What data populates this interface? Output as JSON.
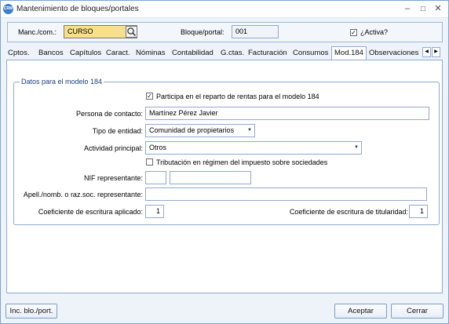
{
  "window": {
    "title": "Mantenimiento de bloques/portales",
    "app_icon_text": "CRM"
  },
  "topbar": {
    "manc_label": "Manc./com.:",
    "manc_value": "CURSO",
    "bloque_label": "Bloque/portal:",
    "bloque_value": "001",
    "activa_label": "¿Activa?",
    "activa_checked": true
  },
  "tabs": [
    {
      "label": "Cptos."
    },
    {
      "label": "Bancos"
    },
    {
      "label": "Capítulos"
    },
    {
      "label": "Caract."
    },
    {
      "label": "Nóminas"
    },
    {
      "label": "Contabilidad"
    },
    {
      "label": "G.ctas."
    },
    {
      "label": "Facturación"
    },
    {
      "label": "Consumos"
    },
    {
      "label": "Mod.184",
      "active": true
    },
    {
      "label": "Observaciones"
    }
  ],
  "modelo184": {
    "group_title": "Datos para el modelo 184",
    "participa_label": "Participa en el reparto de rentas para el modelo 184",
    "participa_checked": true,
    "contacto_label": "Persona de contacto:",
    "contacto_value": "Martínez Pérez Javier",
    "tipo_label": "Tipo de entidad:",
    "tipo_value": "Comunidad de propietarios",
    "actividad_label": "Actividad principal:",
    "actividad_value": "Otros",
    "tributacion_label": "Tributación en régimen del impuesto sobre sociedades",
    "tributacion_checked": false,
    "nif_label": "NIF representante:",
    "nif_prefix_value": "",
    "nif_value": "",
    "apell_label": "Apell./nomb. o raz.soc. representante:",
    "apell_value": "",
    "coef_aplicado_label": "Coeficiente de escritura aplicado:",
    "coef_aplicado_value": "1",
    "coef_titularidad_label": "Coeficiente de escritura de titularidad:",
    "coef_titularidad_value": "1"
  },
  "footer": {
    "inc_label": "Inc. blo./port.",
    "aceptar_label": "Aceptar",
    "cerrar_label": "Cerrar"
  },
  "icons": {
    "checkmark": "✓",
    "close": "✕",
    "minimize": "–",
    "maximize": "□",
    "combo_arrow": "▼",
    "arrow_left": "◀",
    "arrow_right": "▶"
  }
}
